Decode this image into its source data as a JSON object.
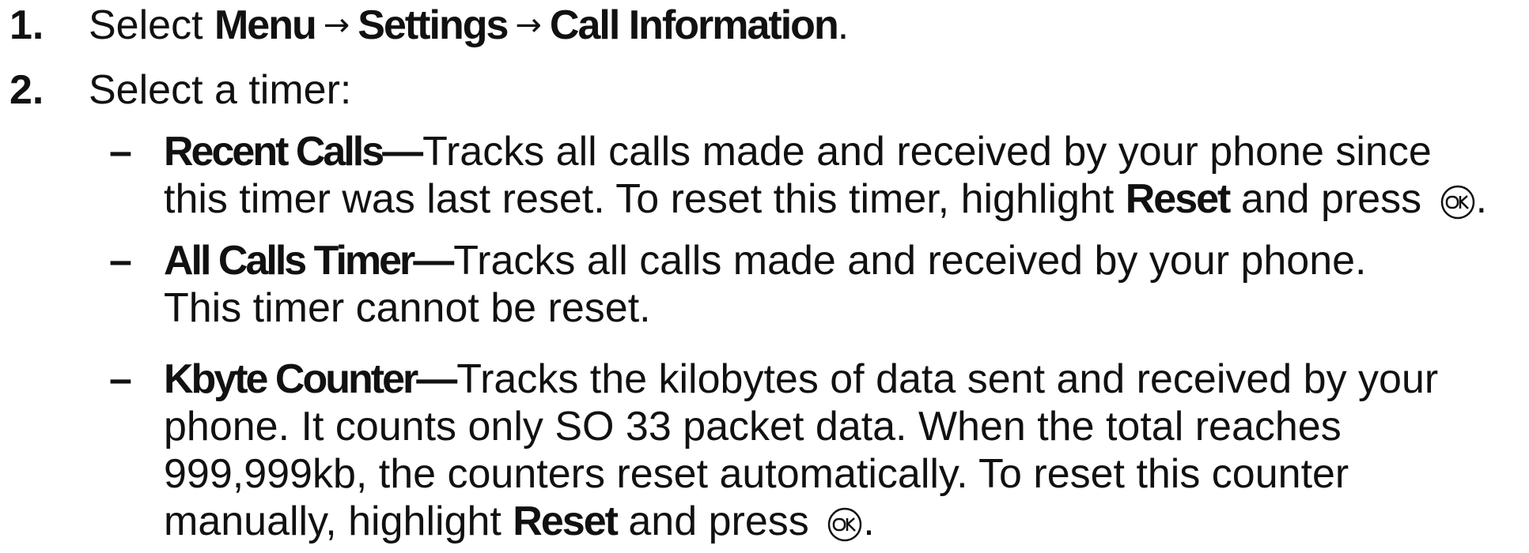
{
  "steps": [
    {
      "number": "1.",
      "parts": {
        "prefix": "Select ",
        "menu": "Menu",
        "arrow1": "→",
        "settings": "Settings",
        "arrow2": "→",
        "call_info": "Call Information",
        "suffix": "."
      }
    },
    {
      "number": "2.",
      "text": "Select a timer:"
    }
  ],
  "timers": [
    {
      "dash": "–",
      "term": "Recent Calls—",
      "line1": "Tracks all calls made and received by your phone since",
      "line2_prefix": "this timer was last reset. To reset this timer, highlight ",
      "line2_keyword": "Reset",
      "line2_suffix": " and press ",
      "end": "."
    },
    {
      "dash": "–",
      "term": "All Calls Timer—",
      "line1": "Tracks all calls made and received by your phone.",
      "line2": "This timer cannot be reset."
    },
    {
      "dash": "–",
      "term": "Kbyte Counter—",
      "line1": "Tracks the kilobytes of data sent and received by your",
      "line2": "phone. It counts only SO 33 packet data. When the total reaches",
      "line3": "999,999kb, the counters reset automatically. To reset this counter",
      "line4_prefix": "manually, highlight ",
      "line4_keyword": "Reset",
      "line4_suffix": " and press ",
      "end": "."
    }
  ],
  "icons": {
    "ok_key": "ok-key-icon"
  }
}
